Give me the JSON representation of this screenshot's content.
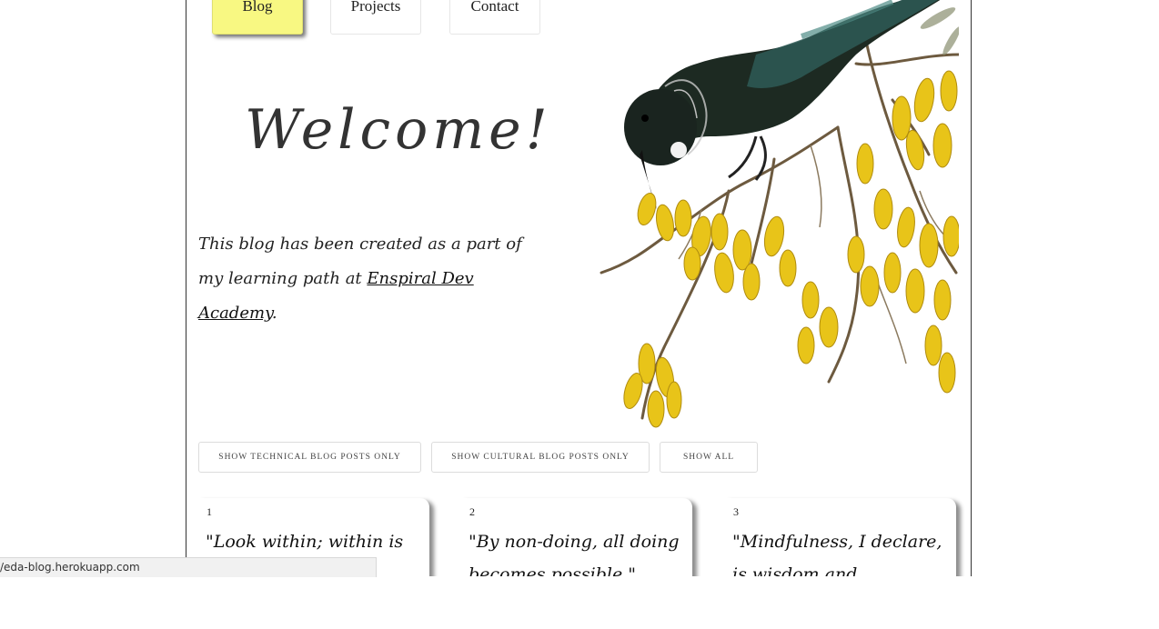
{
  "nav": {
    "items": [
      {
        "label": "Blog",
        "active": true
      },
      {
        "label": "Projects",
        "active": false
      },
      {
        "label": "Contact",
        "active": false
      }
    ]
  },
  "hero": {
    "title": "Welcome!",
    "intro_text": "This blog has been created as a part of my learning path at ",
    "intro_link": "Enspiral Dev Academy",
    "intro_end": ".",
    "image": "tui-bird-on-kowhai-flowers"
  },
  "filters": {
    "technical": "SHOW TECHNICAL BLOG POSTS ONLY",
    "cultural": "SHOW CULTURAL BLOG POSTS ONLY",
    "all": "SHOW ALL"
  },
  "posts": [
    {
      "number": "1",
      "quote": "\"Look within; within is the"
    },
    {
      "number": "2",
      "quote": "\"By non-doing, all doing becomes possible.\""
    },
    {
      "number": "3",
      "quote": "\"Mindfulness, I declare, is wisdom and..."
    }
  ],
  "status_bar": {
    "url": "/eda-blog.herokuapp.com"
  },
  "colors": {
    "active_nav": "#f8f882",
    "flower_yellow": "#e8c419",
    "bird_dark": "#1d2a22"
  }
}
